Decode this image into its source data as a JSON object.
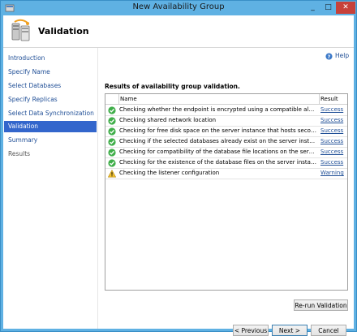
{
  "window": {
    "title": "New Availability Group"
  },
  "header": {
    "title": "Validation"
  },
  "sidebar": {
    "items": [
      {
        "label": "Introduction",
        "state": "normal"
      },
      {
        "label": "Specify Name",
        "state": "normal"
      },
      {
        "label": "Select Databases",
        "state": "normal"
      },
      {
        "label": "Specify Replicas",
        "state": "normal"
      },
      {
        "label": "Select Data Synchronization",
        "state": "normal"
      },
      {
        "label": "Validation",
        "state": "selected"
      },
      {
        "label": "Summary",
        "state": "normal"
      },
      {
        "label": "Results",
        "state": "disabled"
      }
    ]
  },
  "main": {
    "help_label": "Help",
    "results_label": "Results of availability group validation.",
    "grid": {
      "columns": [
        "Name",
        "Result"
      ],
      "rows": [
        {
          "icon": "success-check-icon",
          "name": "Checking whether the endpoint is encrypted using a compatible algorithm",
          "result": "Success"
        },
        {
          "icon": "success-check-icon",
          "name": "Checking shared network location",
          "result": "Success"
        },
        {
          "icon": "success-check-icon",
          "name": "Checking for free disk space on the server instance that hosts secondary re...",
          "result": "Success"
        },
        {
          "icon": "success-check-icon",
          "name": "Checking if the selected databases already exist on the server instance that ...",
          "result": "Success"
        },
        {
          "icon": "success-check-icon",
          "name": "Checking for compatibility of the database file locations on the server insta...",
          "result": "Success"
        },
        {
          "icon": "success-check-icon",
          "name": "Checking for the existence of the database files on the server instance that ...",
          "result": "Success"
        },
        {
          "icon": "warning-icon",
          "name": "Checking the listener configuration",
          "result": "Warning"
        }
      ]
    },
    "rerun_label": "Re-run Validation"
  },
  "footer": {
    "previous_label": "< Previous",
    "next_label": "Next >",
    "cancel_label": "Cancel"
  },
  "colors": {
    "titlebar": "#5fb1e3",
    "selected_nav": "#3366cc",
    "link": "#1f4e96",
    "success": "#3fae49",
    "warning": "#f2c230",
    "close_button": "#c7413a"
  }
}
